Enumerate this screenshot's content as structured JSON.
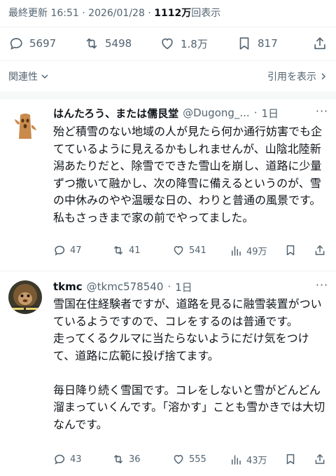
{
  "meta": {
    "updated_label": "最終更新",
    "time": "16:51",
    "dot": "·",
    "date": "2026/01/28",
    "views": "1112万",
    "views_suffix": "回表示"
  },
  "stats": {
    "replies": "5697",
    "retweets": "5498",
    "likes": "1.8万",
    "bookmarks": "817"
  },
  "sort": {
    "relevance_label": "関連性",
    "quotes_label": "引用を表示"
  },
  "replies": [
    {
      "name": "はんたろう、または儒艮堂",
      "handle": "@Dugong_...",
      "time": "1日",
      "text": "殆ど積雪のない地域の人が見たら何か通行妨害でも企てているように見えるかもしれませんが、山陰北陸新潟あたりだと、除雪でできた雪山を崩し、道路に少量ずつ撒いて融かし、次の降雪に備えるというのが、雪の中休みのやや温暖な日の、わりと普通の風景です。私もさっきまで家の前でやってました。",
      "replies": "47",
      "retweets": "41",
      "likes": "541",
      "views": "49万"
    },
    {
      "name": "tkmc",
      "handle": "@tkmc578540",
      "time": "1日",
      "text": "雪国在住経験者ですが、道路を見るに融雪装置がついているようですので、コレをするのは普通です。\n走ってくるクルマに当たらないようにだけ気をつけて、道路に広範に投げ捨てます。\n\n毎日降り続く雪国です。コレをしないと雪がどんどん溜まっていくんです。「溶かす」ことも雪かきでは大切なんです。",
      "replies": "43",
      "retweets": "36",
      "likes": "555",
      "views": "43万"
    }
  ],
  "colors": {
    "text": "#0f1419",
    "secondary": "#536471",
    "divider": "#eff3f4"
  }
}
